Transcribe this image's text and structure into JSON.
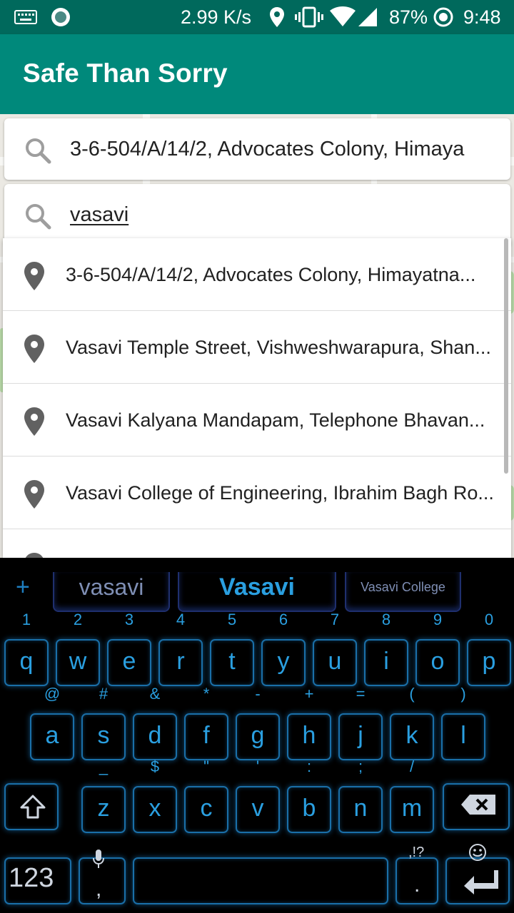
{
  "status_bar": {
    "net_speed": "2.99 K/s",
    "battery": "87%",
    "time": "9:48"
  },
  "app_bar": {
    "title": "Safe Than Sorry"
  },
  "search": {
    "origin_value": "3-6-504/A/14/2, Advocates Colony, Himaya",
    "destination_value": "vasavi"
  },
  "suggestions": [
    {
      "text": "3-6-504/A/14/2, Advocates Colony, Himayatna..."
    },
    {
      "text": "Vasavi Temple Street, Vishweshwarapura, Shan..."
    },
    {
      "text": "Vasavi Kalyana Mandapam, Telephone Bhavan..."
    },
    {
      "text": "Vasavi College of Engineering, Ibrahim Bagh Ro..."
    }
  ],
  "keyboard": {
    "word_suggestions": [
      "vasavi",
      "Vasavi",
      "Vasavi College"
    ],
    "row1": [
      {
        "main": "q",
        "top": "1"
      },
      {
        "main": "w",
        "top": "2"
      },
      {
        "main": "e",
        "top": "3"
      },
      {
        "main": "r",
        "top": "4"
      },
      {
        "main": "t",
        "top": "5"
      },
      {
        "main": "y",
        "top": "6"
      },
      {
        "main": "u",
        "top": "7"
      },
      {
        "main": "i",
        "top": "8"
      },
      {
        "main": "o",
        "top": "9"
      },
      {
        "main": "p",
        "top": "0"
      }
    ],
    "row2": [
      {
        "main": "a",
        "top": "@"
      },
      {
        "main": "s",
        "top": "#"
      },
      {
        "main": "d",
        "top": "&"
      },
      {
        "main": "f",
        "top": "*"
      },
      {
        "main": "g",
        "top": "-"
      },
      {
        "main": "h",
        "top": "+"
      },
      {
        "main": "j",
        "top": "="
      },
      {
        "main": "k",
        "top": "("
      },
      {
        "main": "l",
        "top": ")"
      }
    ],
    "row3": [
      {
        "main": "z",
        "top": "_"
      },
      {
        "main": "x",
        "top": "$"
      },
      {
        "main": "c",
        "top": "\""
      },
      {
        "main": "v",
        "top": "'"
      },
      {
        "main": "b",
        "top": ":"
      },
      {
        "main": "n",
        "top": ";"
      },
      {
        "main": "m",
        "top": "/"
      }
    ],
    "numbers_label": "123",
    "comma": ",",
    "period": ".",
    "punct_label": ",!?"
  },
  "icons": {
    "keyboard": "keyboard-icon",
    "shield": "circle-status-icon",
    "location": "location-pin-icon",
    "vibrate": "vibrate-icon",
    "wifi": "wifi-icon",
    "signal": "signal-icon",
    "sync": "sync-circle-icon",
    "search": "search-icon",
    "pin": "place-pin-icon",
    "shift": "shift-icon",
    "backspace": "backspace-icon",
    "mic": "mic-icon",
    "emoji": "emoji-icon",
    "enter": "enter-icon"
  }
}
